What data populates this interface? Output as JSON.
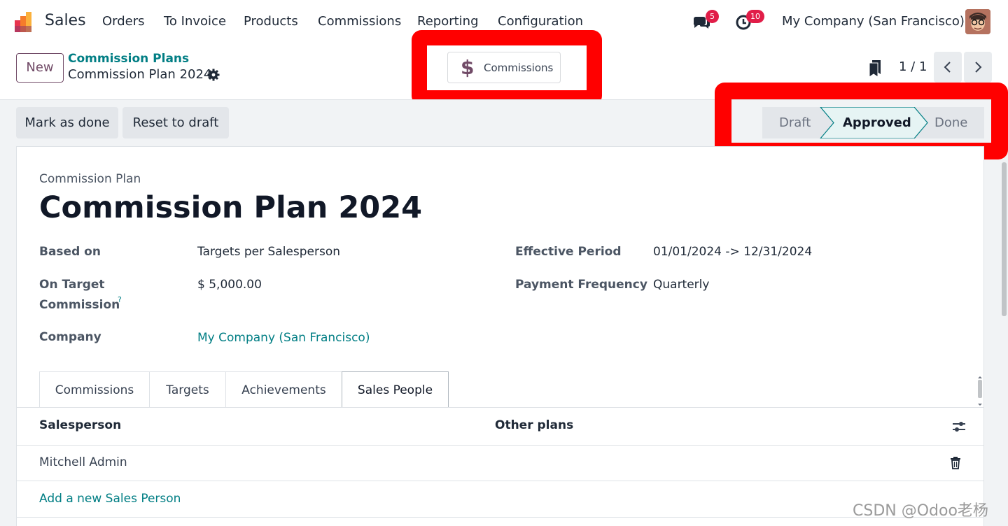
{
  "navbar": {
    "app_name": "Sales",
    "menu": [
      "Orders",
      "To Invoice",
      "Products",
      "Commissions",
      "Reporting",
      "Configuration"
    ],
    "messages_count": "5",
    "activities_count": "10",
    "company": "My Company (San Francisco)"
  },
  "control": {
    "new_label": "New",
    "breadcrumb_parent": "Commission Plans",
    "record_name": "Commission Plan 2024",
    "smart_button_label": "Commissions",
    "pager": "1 / 1"
  },
  "actions": {
    "mark_done": "Mark as done",
    "reset_draft": "Reset to draft"
  },
  "statusbar": {
    "stages": [
      "Draft",
      "Approved",
      "Done"
    ],
    "current": "Approved"
  },
  "form": {
    "subtitle": "Commission Plan",
    "title": "Commission Plan 2024",
    "based_on_label": "Based on",
    "based_on_value": "Targets per Salesperson",
    "on_target_label_1": "On Target",
    "on_target_label_2": "Commission",
    "help_mark": "?",
    "on_target_value": "$ 5,000.00",
    "company_label": "Company",
    "company_value": "My Company (San Francisco)",
    "period_label": "Effective Period",
    "period_value": "01/01/2024 -> 12/31/2024",
    "frequency_label": "Payment Frequency",
    "frequency_value": "Quarterly"
  },
  "tabs": [
    "Commissions",
    "Targets",
    "Achievements",
    "Sales People"
  ],
  "active_tab": "Sales People",
  "table": {
    "columns": [
      "Salesperson",
      "Other plans"
    ],
    "rows": [
      {
        "salesperson": "Mitchell Admin",
        "other_plans": ""
      }
    ],
    "add_line": "Add a new Sales Person"
  },
  "watermark": "CSDN @Odoo老杨",
  "colors": {
    "brand": "#714b67",
    "link": "#017e84",
    "highlight": "#ff0000",
    "badge": "#e11d48"
  }
}
